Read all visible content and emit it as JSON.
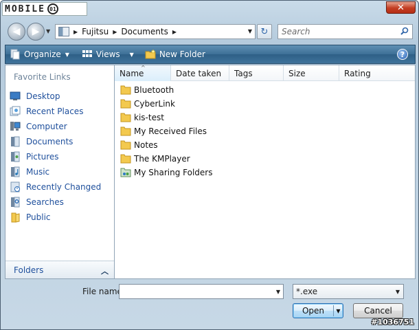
{
  "titlebar": {
    "brand_text": "MOBILE",
    "brand_ring": "01",
    "close_label": "✕"
  },
  "nav": {
    "back_label": "◀",
    "forward_label": "▶",
    "history_drop": "▼",
    "address": {
      "segments": [
        "Fujitsu",
        "Documents"
      ],
      "sep": "▶",
      "drop": "▼"
    },
    "refresh_label": "↻",
    "search_placeholder": "Search"
  },
  "toolbar": {
    "items": [
      {
        "label": "Organize",
        "icon": "organize-icon",
        "has_arrow": true
      },
      {
        "label": "Views",
        "icon": "views-icon",
        "has_arrow": true
      },
      {
        "label": "New Folder",
        "icon": "new-folder-icon",
        "has_arrow": false
      }
    ],
    "arrow": "▼",
    "help_label": "?"
  },
  "sidebar": {
    "title": "Favorite Links",
    "items": [
      {
        "label": "Desktop",
        "icon": "desktop-icon"
      },
      {
        "label": "Recent Places",
        "icon": "recent-places-icon"
      },
      {
        "label": "Computer",
        "icon": "computer-icon"
      },
      {
        "label": "Documents",
        "icon": "documents-icon"
      },
      {
        "label": "Pictures",
        "icon": "pictures-icon"
      },
      {
        "label": "Music",
        "icon": "music-icon"
      },
      {
        "label": "Recently Changed",
        "icon": "recently-changed-icon"
      },
      {
        "label": "Searches",
        "icon": "searches-icon"
      },
      {
        "label": "Public",
        "icon": "public-icon"
      }
    ],
    "folders_label": "Folders",
    "folders_chevron": "︿"
  },
  "file_list": {
    "columns": [
      "Name",
      "Date taken",
      "Tags",
      "Size",
      "Rating"
    ],
    "sort_indicator": "^",
    "items": [
      {
        "name": "Bluetooth",
        "icon": "folder-icon"
      },
      {
        "name": "CyberLink",
        "icon": "folder-icon"
      },
      {
        "name": "kis-test",
        "icon": "folder-icon"
      },
      {
        "name": "My Received Files",
        "icon": "folder-icon"
      },
      {
        "name": "Notes",
        "icon": "folder-icon"
      },
      {
        "name": "The KMPlayer",
        "icon": "folder-icon"
      },
      {
        "name": "My Sharing Folders",
        "icon": "shared-folder-icon"
      }
    ]
  },
  "footer": {
    "filename_label": "File name:",
    "filename_value": "",
    "filter_value": "*.exe",
    "open_label": "Open",
    "cancel_label": "Cancel",
    "watermark": "#1036751",
    "drop": "▼"
  },
  "colors": {
    "toolbar": "#3d6f96",
    "link": "#1e4f9c",
    "close": "#c33d22"
  }
}
